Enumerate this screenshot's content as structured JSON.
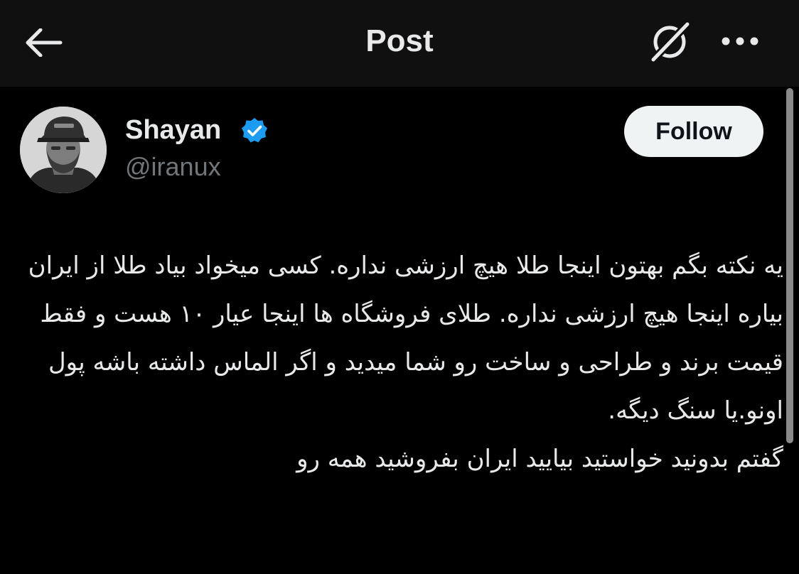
{
  "header": {
    "title": "Post",
    "back_icon": "arrow-left-icon",
    "grok_icon": "grok-icon",
    "more_icon": "more-horizontal-icon"
  },
  "author": {
    "name": "Shayan",
    "handle": "@iranux",
    "verified_icon": "verified-badge-icon",
    "verified_color": "#1d9bf0"
  },
  "actions": {
    "follow_label": "Follow"
  },
  "tweet": {
    "paragraph1": "یه نکته بگم بهتون اینجا طلا هیچ ارزشی نداره. کسی میخواد بیاد طلا از ایران بیاره اینجا هیچ ارزشی نداره. طلای فروشگاه ها اینجا عیار ۱۰ هست و فقط قیمت برند و طراحی و ساخت رو شما میدید و اگر الماس داشته باشه پول اونو.یا سنگ دیگه.",
    "paragraph2": "گفتم بدونید خواستید بیایید ایران بفروشید همه رو"
  },
  "colors": {
    "background": "#000000",
    "header_background": "#101010",
    "text_primary": "#e7e9ea",
    "text_secondary": "#71767b",
    "follow_button_bg": "#eff3f4"
  }
}
